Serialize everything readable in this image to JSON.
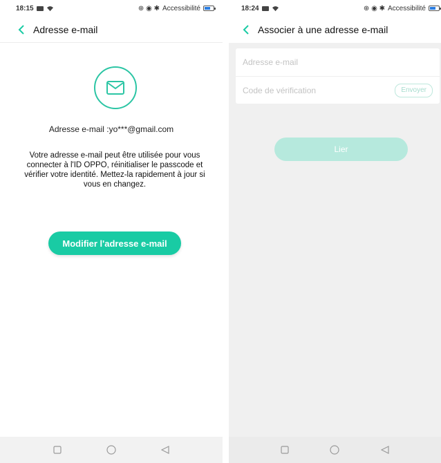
{
  "colors": {
    "accent": "#19cba4",
    "accent_light": "#b6e9dd"
  },
  "screen1": {
    "status": {
      "time": "18:15",
      "accessibility": "Accessibilité"
    },
    "header": {
      "title": "Adresse e-mail"
    },
    "email_line": "Adresse e-mail :yo***@gmail.com",
    "description": "Votre adresse e-mail peut être utilisée pour vous connecter à l'ID OPPO, réinitialiser le passcode et vérifier votre identité. Mettez-la rapidement à jour si vous en changez.",
    "modify_button": "Modifier l'adresse e-mail"
  },
  "screen2": {
    "status": {
      "time": "18:24",
      "accessibility": "Accessibilité"
    },
    "header": {
      "title": "Associer à une adresse e-mail"
    },
    "email_placeholder": "Adresse e-mail",
    "code_placeholder": "Code de vérification",
    "send_button": "Envoyer",
    "link_button": "Lier"
  },
  "icons": [
    "back-arrow-icon",
    "envelope-icon",
    "wifi-icon",
    "message-icon",
    "battery-icon",
    "square-nav-icon",
    "circle-nav-icon",
    "triangle-back-nav-icon"
  ]
}
